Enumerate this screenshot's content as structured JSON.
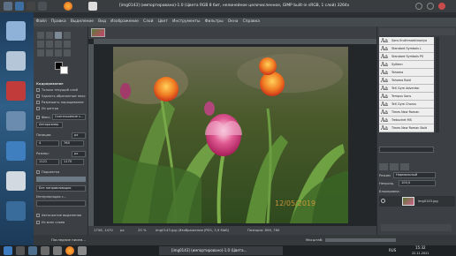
{
  "window": {
    "title": "[img0143] (импортировано)-1.0 (Цвета RGB 8 бит, нелинейное целочисленное, GIMP built-in sRGB, 1 слой) 3264x2448 – GIMP"
  },
  "menubar": {
    "items": [
      "Файл",
      "Правка",
      "Выделение",
      "Вид",
      "Изображение",
      "Слой",
      "Цвет",
      "Инструменты",
      "Фильтры",
      "Окна",
      "Справка"
    ]
  },
  "tool_options": {
    "title": "Кадрирование",
    "only_current_layer": "Только текущий слой",
    "delete_cropped": "Удалить обрезанные пиксели",
    "allow_grow": "Разрешить наращивание",
    "from_center": "Из центра",
    "fixed_label": "Фикс.",
    "fixed_value": "Соотношение с...",
    "fixed_mode": "Авторазмер",
    "position_label": "Позиция:",
    "position_unit": "px",
    "pos_x": "4",
    "pos_y": "760",
    "size_label": "Размер:",
    "size_unit": "px",
    "size_w": "1121",
    "size_h": "1170",
    "highlight": "Подсветка",
    "guides": "Без направляющих",
    "interpolation_label": "Интерполяция с...",
    "auto_shrink": "Автосжатие выделения",
    "merged": "Из всех слоев"
  },
  "canvas": {
    "tab_name": "img0143",
    "photo_date": "12/05/2019"
  },
  "statusbar": {
    "coords": "1756, 1470",
    "unit": "px",
    "zoom": "25 %",
    "message": "img0143.jpg (Изображение JPEG, 3,9 МиБ)",
    "pointer": "Позиция: 856, 760"
  },
  "fonts_panel": {
    "items": [
      "Sans Kruthmakkinaniya",
      "Standard Symbols L",
      "Standard Symbols PS",
      "Sylfaen",
      "Tahoma",
      "Tahoma Bold",
      "TeX Gyre Adventor",
      "Tempus Sans",
      "TeX Gyre Chorus",
      "Times New Roman",
      "Trebuchet MS",
      "Times New Roman Bold"
    ]
  },
  "layers_panel": {
    "mode_label": "Режим",
    "mode_value": "Нормальный",
    "opacity_label": "Непрозр.",
    "opacity_value": "100,0",
    "lock_label": "Блокировка:",
    "layer_name": "img0143.jpg"
  },
  "gimp_bottom": {
    "hint": "Последние писем...",
    "scale_label": "Масштаб:"
  },
  "taskbar": {
    "app_label": "[img0143] (импортировано)-1.0 (Цвета...",
    "lang": "RUS",
    "time": "15:32",
    "date": "22.11.2021"
  }
}
